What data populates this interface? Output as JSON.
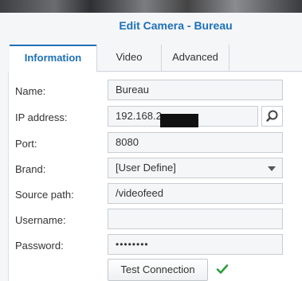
{
  "dialog": {
    "title": "Edit Camera - Bureau"
  },
  "tabs": [
    {
      "label": "Information",
      "active": true
    },
    {
      "label": "Video",
      "active": false
    },
    {
      "label": "Advanced",
      "active": false
    }
  ],
  "form": {
    "name": {
      "label": "Name:",
      "value": "Bureau"
    },
    "ip": {
      "label": "IP address:",
      "value": "192.168.2"
    },
    "port": {
      "label": "Port:",
      "value": "8080"
    },
    "brand": {
      "label": "Brand:",
      "value": "[User Define]"
    },
    "source_path": {
      "label": "Source path:",
      "value": "/videofeed"
    },
    "username": {
      "label": "Username:",
      "value": ""
    },
    "password": {
      "label": "Password:",
      "value": "••••••••"
    }
  },
  "test_button": {
    "label": "Test Connection"
  },
  "colors": {
    "accent": "#1e70b8",
    "success": "#2e9e3e"
  },
  "icons": {
    "search": "search-icon",
    "dropdown": "chevron-down-icon",
    "status": "checkmark-icon"
  }
}
